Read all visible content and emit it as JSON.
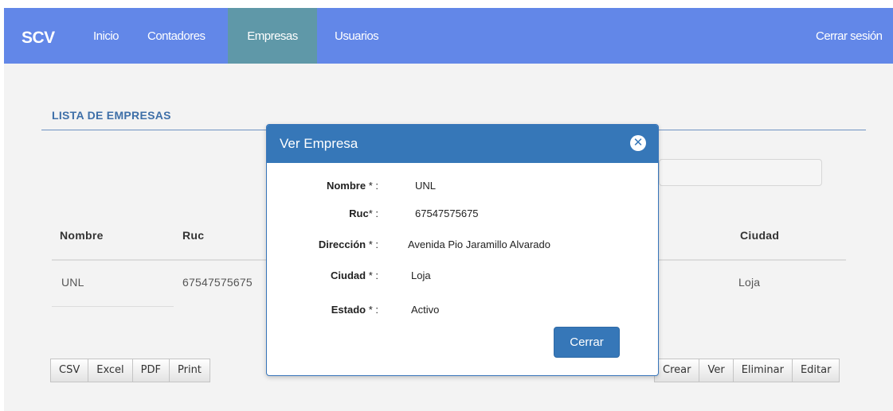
{
  "navbar": {
    "brand": "SCV",
    "items": [
      {
        "label": "Inicio"
      },
      {
        "label": "Contadores"
      },
      {
        "label": "Empresas",
        "active": true
      },
      {
        "label": "Usuarios"
      }
    ],
    "logout": "Cerrar sesión"
  },
  "section": {
    "title": "LISTA DE EMPRESAS"
  },
  "table": {
    "headers": {
      "nombre": "Nombre",
      "ruc": "Ruc",
      "ciudad": "Ciudad"
    },
    "rows": [
      {
        "nombre": "UNL",
        "ruc": "67547575675",
        "ciudad": "Loja"
      }
    ]
  },
  "export_buttons": [
    "CSV",
    "Excel",
    "PDF",
    "Print"
  ],
  "action_buttons": [
    "Crear",
    "Ver",
    "Eliminar",
    "Editar"
  ],
  "modal": {
    "title": "Ver Empresa",
    "fields": [
      {
        "label": "Nombre",
        "marker": " * :",
        "value": "UNL"
      },
      {
        "label": "Ruc",
        "marker": "* :",
        "value": "67547575675"
      },
      {
        "label": "Dirección",
        "marker": " * :",
        "value": "Avenida Pio Jaramillo Alvarado"
      },
      {
        "label": "Ciudad",
        "marker": " * :",
        "value": "Loja"
      },
      {
        "label": "Estado",
        "marker": " * :",
        "value": "Activo"
      }
    ],
    "close_button": "Cerrar"
  },
  "colors": {
    "navbar": "#6287e8",
    "nav_active": "#5f98a8",
    "modal_header": "#3677b8",
    "title_text": "#3e6fa8"
  },
  "icons": {
    "modal_close": "close-circle-icon"
  }
}
